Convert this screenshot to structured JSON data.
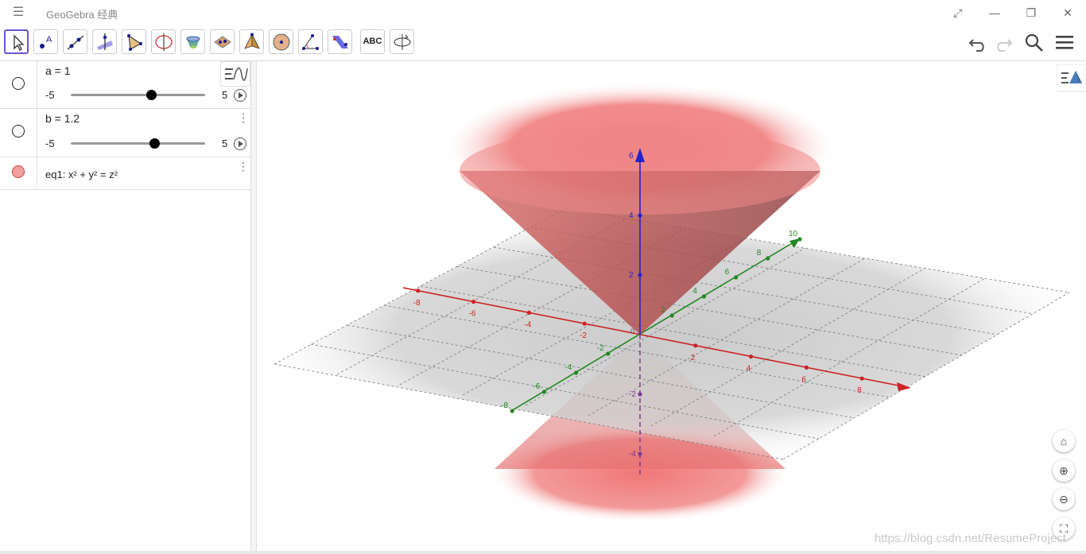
{
  "app": {
    "title": "GeoGebra 经典",
    "menu_icon": "hamburger-icon",
    "window_controls": [
      "expand-icon",
      "minimize-icon",
      "restore-icon",
      "close-icon"
    ]
  },
  "toolbar": {
    "tools": [
      "move-tool-icon",
      "point-tool-icon",
      "line-tool-icon",
      "perpendicular-line-tool-icon",
      "polygon-tool-icon",
      "circle-axis-tool-icon",
      "sphere-tool-icon",
      "plane-tool-icon",
      "pyramid-tool-icon",
      "sphere-center-tool-icon",
      "angle-tool-icon",
      "reflect-tool-icon",
      "text-tool-icon",
      "rotate-view-tool-icon"
    ],
    "text_tool_label": "ABC",
    "right": [
      "undo-icon",
      "redo-icon",
      "search-icon",
      "main-menu-icon"
    ]
  },
  "algebra": {
    "rows": [
      {
        "definition": "a = 1",
        "min": "-5",
        "max": "5",
        "value_fraction": 0.6
      },
      {
        "definition": "b = 1.2",
        "min": "-5",
        "max": "5",
        "value_fraction": 0.62
      },
      {
        "definition": "eq1: x² + y² = z²"
      }
    ]
  },
  "graphics": {
    "x_axis_labels": [
      "-8",
      "-6",
      "-4",
      "-2",
      "2",
      "4",
      "6",
      "8"
    ],
    "y_axis_labels": [
      "-8",
      "-6",
      "-4",
      "-2",
      "2",
      "4",
      "6",
      "8",
      "10"
    ],
    "z_axis_labels": [
      "6",
      "4",
      "2",
      "-2",
      "-4"
    ],
    "origin_label": "0",
    "buttons": [
      "home-icon",
      "zoom-in-icon",
      "zoom-out-icon",
      "fullscreen-icon"
    ]
  },
  "watermark": "https://blog.csdn.net/ResumeProject",
  "colors": {
    "x_axis": "#cc2222",
    "y_axis": "#228822",
    "z_axis": "#2222cc",
    "cone": "#e05a5a",
    "accent": "#6557d2"
  }
}
